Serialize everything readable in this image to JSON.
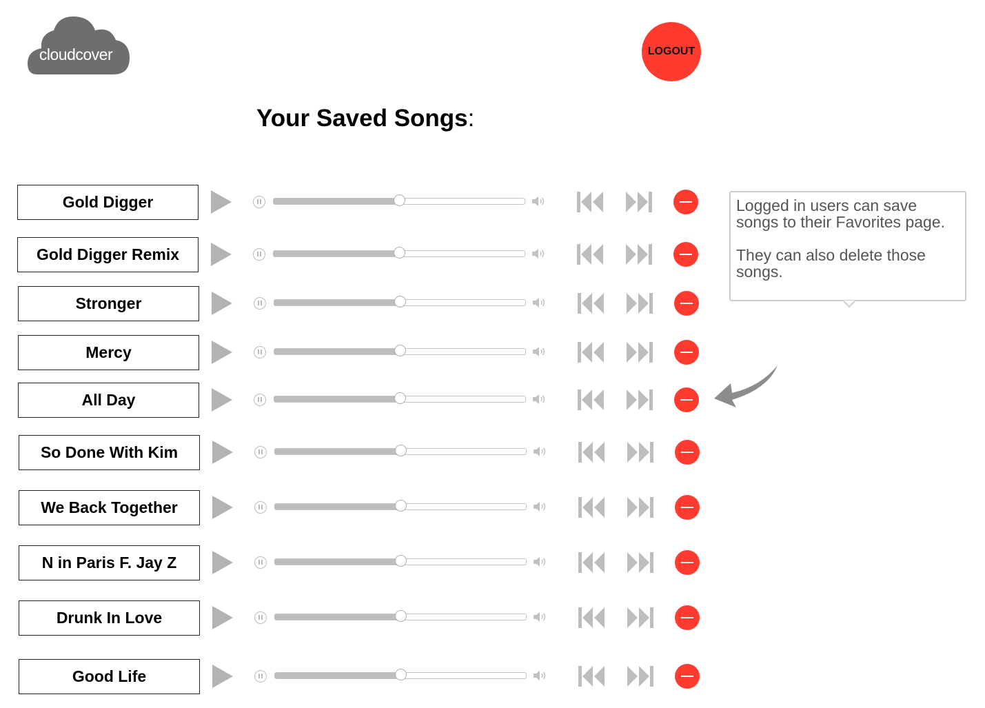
{
  "header": {
    "logo_text": "cloudcover",
    "logout_label": "LOGOUT"
  },
  "page": {
    "title": "Your Saved Songs",
    "title_suffix": ":"
  },
  "songs": [
    {
      "title": "Gold Digger",
      "progress": 0.5
    },
    {
      "title": "Gold Digger Remix",
      "progress": 0.5
    },
    {
      "title": "Stronger",
      "progress": 0.5
    },
    {
      "title": "Mercy",
      "progress": 0.5
    },
    {
      "title": "All Day",
      "progress": 0.5
    },
    {
      "title": "So Done With Kim",
      "progress": 0.5
    },
    {
      "title": "We Back Together",
      "progress": 0.5
    },
    {
      "title": "N in Paris F. Jay Z",
      "progress": 0.5
    },
    {
      "title": "Drunk In Love",
      "progress": 0.5
    },
    {
      "title": "Good Life",
      "progress": 0.5
    }
  ],
  "callout": {
    "line1": "Logged in users can save songs to their Favorites page.",
    "line2": "They can also delete those songs."
  },
  "icons": {
    "logo": "cloud-icon",
    "play": "play-icon",
    "pause": "pause-icon",
    "volume": "volume-icon",
    "previous": "skip-back-icon",
    "next": "skip-forward-icon",
    "delete": "minus-circle-icon",
    "pointer": "curved-arrow-icon"
  },
  "colors": {
    "accent": "#ff3b2f",
    "control_gray": "#b3b3b3",
    "logo_gray": "#6e6e6e",
    "callout_text": "#555555"
  }
}
